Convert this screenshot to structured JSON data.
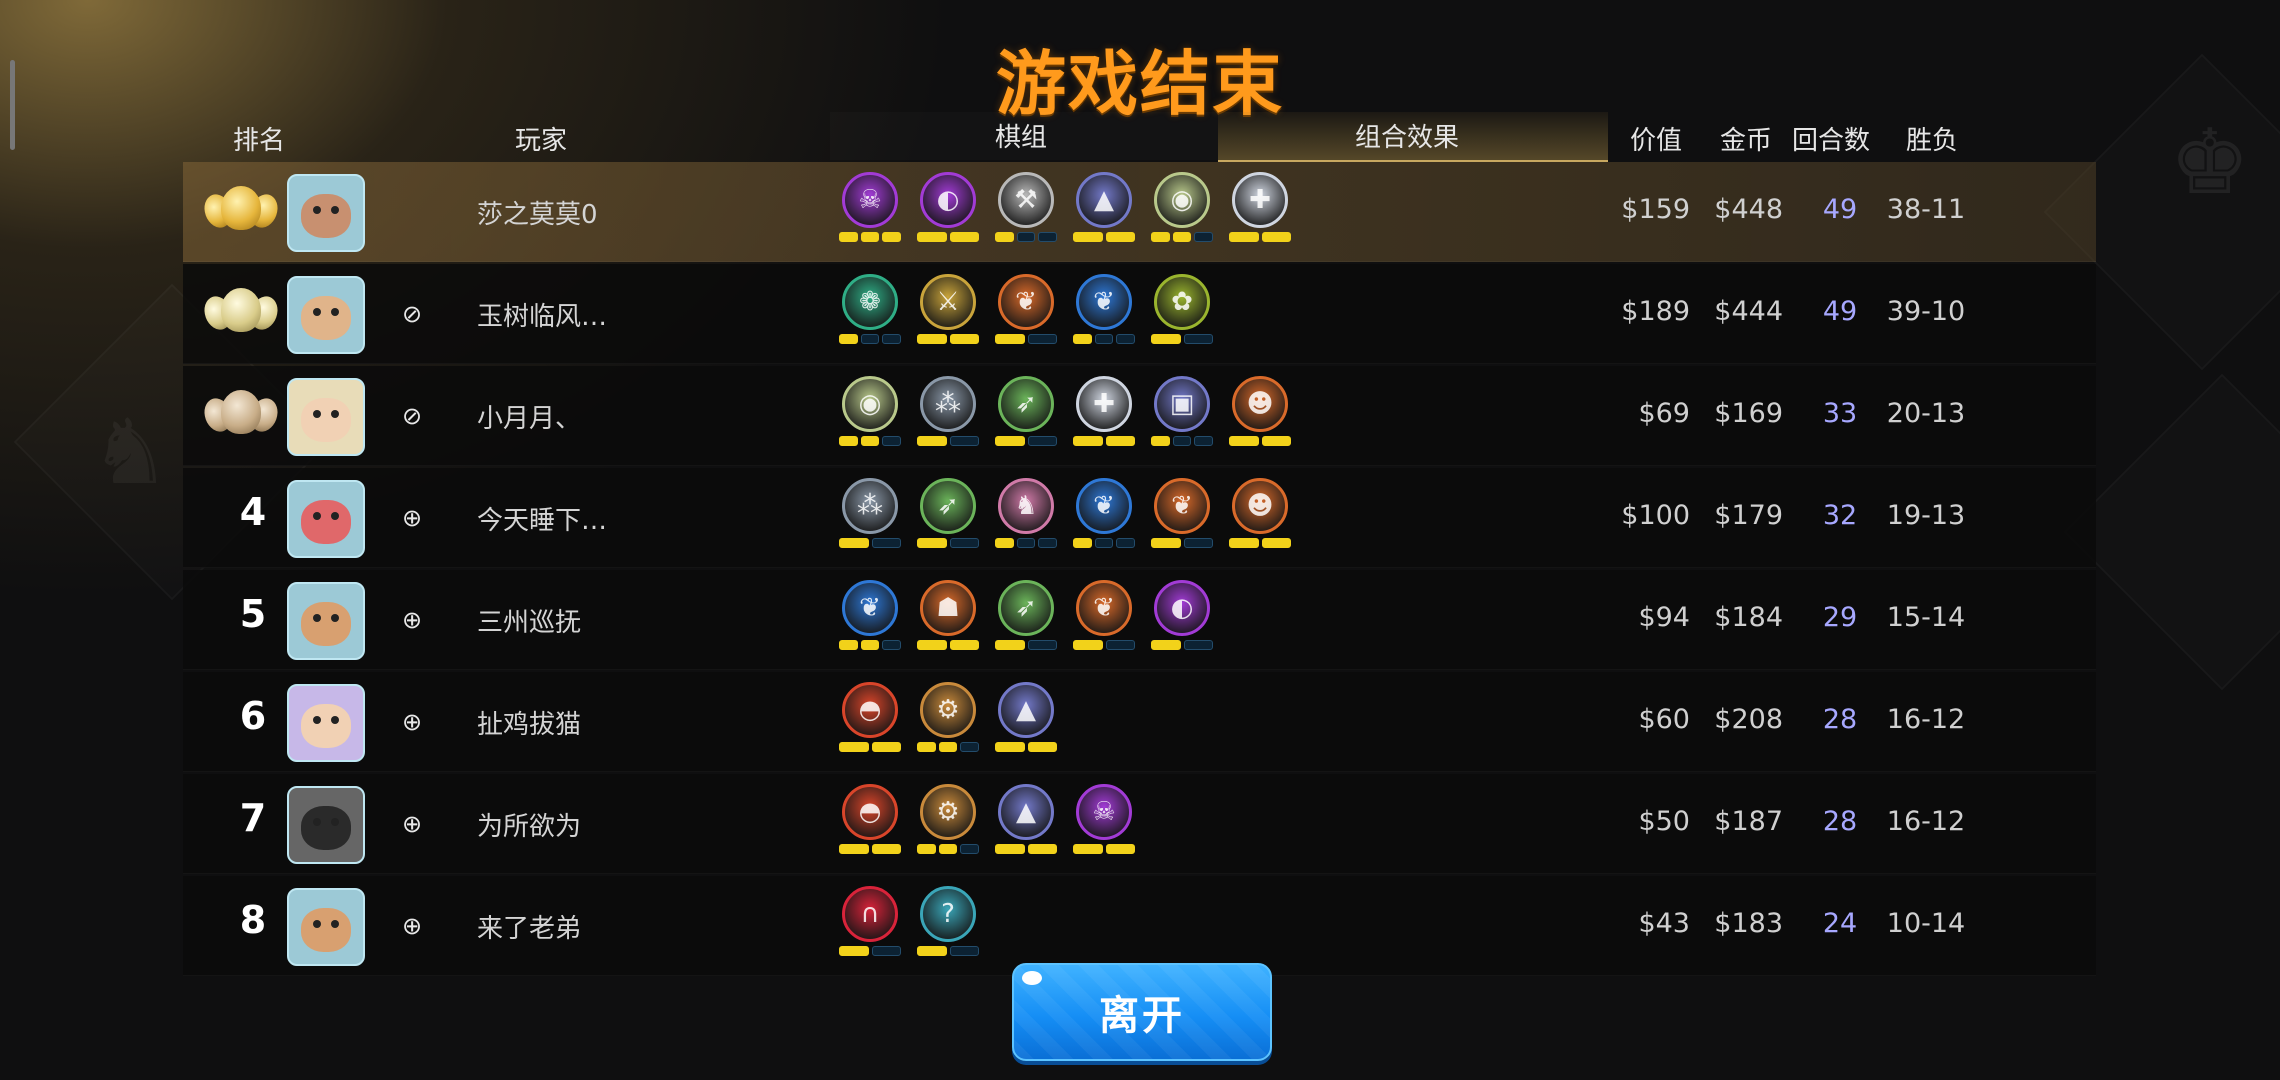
{
  "title": "游戏结束",
  "headers": {
    "rank": "排名",
    "player": "玩家",
    "pieces": "棋组",
    "combo": "组合效果",
    "value": "价值",
    "gold": "金币",
    "rounds": "回合数",
    "record": "胜负"
  },
  "leave_label": "离开",
  "colors": {
    "title": "#ff9a1c",
    "rounds": "#a7a8ff",
    "bar_on": "#f2d21a",
    "button": "#158ef5"
  },
  "players": [
    {
      "rank": "1",
      "medal": "gold",
      "name": "莎之莫莫0",
      "friend": "",
      "value": "$159",
      "gold": "$448",
      "rounds": "49",
      "record": "38-11",
      "avatar": {
        "frame": "#9cc9d6",
        "face": "#c89070"
      },
      "pieces": [
        {
          "icon": "skull-icon",
          "color": "#a23bd6",
          "bars": [
            1,
            1,
            1
          ]
        },
        {
          "icon": "mask-icon",
          "color": "#a23bd6",
          "bars": [
            1,
            1
          ]
        },
        {
          "icon": "axe-icon",
          "color": "#b9b9b9",
          "bars": [
            1,
            0,
            0
          ]
        },
        {
          "icon": "wizard-hat-icon",
          "color": "#7379c9",
          "bars": [
            1,
            1
          ]
        },
        {
          "icon": "bird-icon",
          "color": "#b9c98b",
          "bars": [
            1,
            1,
            0
          ]
        },
        {
          "icon": "cross-icon",
          "color": "#cfd5e0",
          "bars": [
            1,
            1
          ]
        }
      ]
    },
    {
      "rank": "2",
      "medal": "silver",
      "name": "玉树临风…",
      "friend": "✓",
      "value": "$189",
      "gold": "$444",
      "rounds": "49",
      "record": "39-10",
      "avatar": {
        "frame": "#9cc9d6",
        "face": "#e0b48a"
      },
      "pieces": [
        {
          "icon": "paw-icon",
          "color": "#2fae86",
          "bars": [
            1,
            0,
            0
          ]
        },
        {
          "icon": "blades-icon",
          "color": "#c9a43b",
          "bars": [
            1,
            1
          ]
        },
        {
          "icon": "feather-icon",
          "color": "#d96a2a",
          "bars": [
            1,
            0
          ]
        },
        {
          "icon": "feather-icon",
          "color": "#2e78d6",
          "bars": [
            1,
            0,
            0
          ]
        },
        {
          "icon": "cluster-icon",
          "color": "#9ab52e",
          "bars": [
            1,
            0
          ]
        }
      ]
    },
    {
      "rank": "3",
      "medal": "bronze",
      "name": "小月月、",
      "friend": "✓",
      "value": "$69",
      "gold": "$169",
      "rounds": "33",
      "record": "20-13",
      "avatar": {
        "frame": "#e8dcb8",
        "face": "#f1d1b4"
      },
      "pieces": [
        {
          "icon": "bird-icon",
          "color": "#b9c98b",
          "bars": [
            1,
            1,
            0
          ]
        },
        {
          "icon": "tracks-icon",
          "color": "#8a98a8",
          "bars": [
            1,
            0
          ]
        },
        {
          "icon": "bow-icon",
          "color": "#6bb45a",
          "bars": [
            1,
            0
          ]
        },
        {
          "icon": "cross-icon",
          "color": "#cfd5e0",
          "bars": [
            1,
            1
          ]
        },
        {
          "icon": "screen-icon",
          "color": "#7379c9",
          "bars": [
            1,
            0,
            0
          ]
        },
        {
          "icon": "demon-icon",
          "color": "#d96a2a",
          "bars": [
            1,
            1
          ]
        }
      ]
    },
    {
      "rank": "4",
      "medal": "",
      "name": "今天睡下…",
      "friend": "+",
      "value": "$100",
      "gold": "$179",
      "rounds": "32",
      "record": "19-13",
      "avatar": {
        "frame": "#9cc9d6",
        "face": "#e0686a"
      },
      "pieces": [
        {
          "icon": "tracks-icon",
          "color": "#8a98a8",
          "bars": [
            1,
            0
          ]
        },
        {
          "icon": "bow-icon",
          "color": "#6bb45a",
          "bars": [
            1,
            0
          ]
        },
        {
          "icon": "knight-icon",
          "color": "#d07aa8",
          "bars": [
            1,
            0,
            0
          ]
        },
        {
          "icon": "feather-icon",
          "color": "#2e78d6",
          "bars": [
            1,
            0,
            0
          ]
        },
        {
          "icon": "feather-icon",
          "color": "#d96a2a",
          "bars": [
            1,
            0
          ]
        },
        {
          "icon": "demon-icon",
          "color": "#d96a2a",
          "bars": [
            1,
            1
          ]
        }
      ]
    },
    {
      "rank": "5",
      "medal": "",
      "name": "三州巡抚",
      "friend": "+",
      "value": "$94",
      "gold": "$184",
      "rounds": "29",
      "record": "15-14",
      "avatar": {
        "frame": "#9cc9d6",
        "face": "#d8a070"
      },
      "pieces": [
        {
          "icon": "feather-icon",
          "color": "#2e78d6",
          "bars": [
            1,
            1,
            0
          ]
        },
        {
          "icon": "viking-icon",
          "color": "#d96a2a",
          "bars": [
            1,
            1
          ]
        },
        {
          "icon": "bow-icon",
          "color": "#6bb45a",
          "bars": [
            1,
            0
          ]
        },
        {
          "icon": "feather-icon",
          "color": "#d96a2a",
          "bars": [
            1,
            0
          ]
        },
        {
          "icon": "mask-icon",
          "color": "#a23bd6",
          "bars": [
            1,
            0
          ]
        }
      ]
    },
    {
      "rank": "6",
      "medal": "",
      "name": "扯鸡拔猫",
      "friend": "+",
      "value": "$60",
      "gold": "$208",
      "rounds": "28",
      "record": "16-12",
      "avatar": {
        "frame": "#c7b8e8",
        "face": "#f1d1b4"
      },
      "pieces": [
        {
          "icon": "goblin-icon",
          "color": "#d9452a",
          "bars": [
            1,
            1
          ]
        },
        {
          "icon": "gear-icon",
          "color": "#c98a3b",
          "bars": [
            1,
            1,
            0
          ]
        },
        {
          "icon": "wizard-hat-icon",
          "color": "#7379c9",
          "bars": [
            1,
            1
          ]
        }
      ]
    },
    {
      "rank": "7",
      "medal": "",
      "name": "为所欲为",
      "friend": "+",
      "value": "$50",
      "gold": "$187",
      "rounds": "28",
      "record": "16-12",
      "avatar": {
        "frame": "#666666",
        "face": "#2a2a2a"
      },
      "pieces": [
        {
          "icon": "goblin-icon",
          "color": "#d9452a",
          "bars": [
            1,
            1
          ]
        },
        {
          "icon": "gear-icon",
          "color": "#c98a3b",
          "bars": [
            1,
            1,
            0
          ]
        },
        {
          "icon": "wizard-hat-icon",
          "color": "#7379c9",
          "bars": [
            1,
            1
          ]
        },
        {
          "icon": "skull-icon",
          "color": "#a23bd6",
          "bars": [
            1,
            1
          ]
        }
      ]
    },
    {
      "rank": "8",
      "medal": "",
      "name": "来了老弟",
      "friend": "+",
      "value": "$43",
      "gold": "$183",
      "rounds": "24",
      "record": "10-14",
      "avatar": {
        "frame": "#9cc9d6",
        "face": "#d8a070"
      },
      "pieces": [
        {
          "icon": "arch-icon",
          "color": "#d9233a",
          "bars": [
            1,
            0
          ]
        },
        {
          "icon": "question-icon",
          "color": "#3aa6b8",
          "bars": [
            1,
            0
          ]
        }
      ]
    }
  ]
}
